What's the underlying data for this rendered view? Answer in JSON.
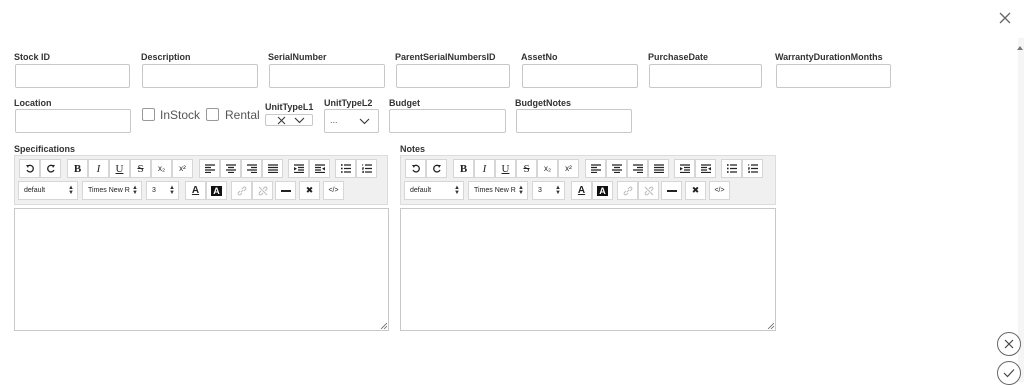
{
  "form": {
    "stock_id_label": "Stock ID",
    "description_label": "Description",
    "serial_number_label": "SerialNumber",
    "parent_serial_label": "ParentSerialNumbersID",
    "asset_no_label": "AssetNo",
    "purchase_date_label": "PurchaseDate",
    "warranty_label": "WarrantyDurationMonths",
    "location_label": "Location",
    "instock_label": "InStock",
    "rental_label": "Rental",
    "unit_type_l1_label": "UnitTypeL1",
    "unit_type_l2_label": "UnitTypeL2",
    "unit_type_l2_value": "...",
    "budget_label": "Budget",
    "budget_notes_label": "BudgetNotes"
  },
  "editors": [
    {
      "label": "Specifications",
      "paragraph_format": "default",
      "font_family": "Times New R",
      "font_size": "3"
    },
    {
      "label": "Notes",
      "paragraph_format": "default",
      "font_family": "Times New R",
      "font_size": "3"
    }
  ],
  "toolbar_glyphs": {
    "bold": "B",
    "italic": "I",
    "underline": "U",
    "strike": "S",
    "subscript": "x₂",
    "superscript": "x²",
    "text_color": "A",
    "bg_color": "A",
    "remove_format": "✖",
    "source": "</>"
  },
  "icons": {
    "close": "close-icon",
    "cancel": "cancel-circle-icon",
    "confirm": "check-circle-icon"
  }
}
